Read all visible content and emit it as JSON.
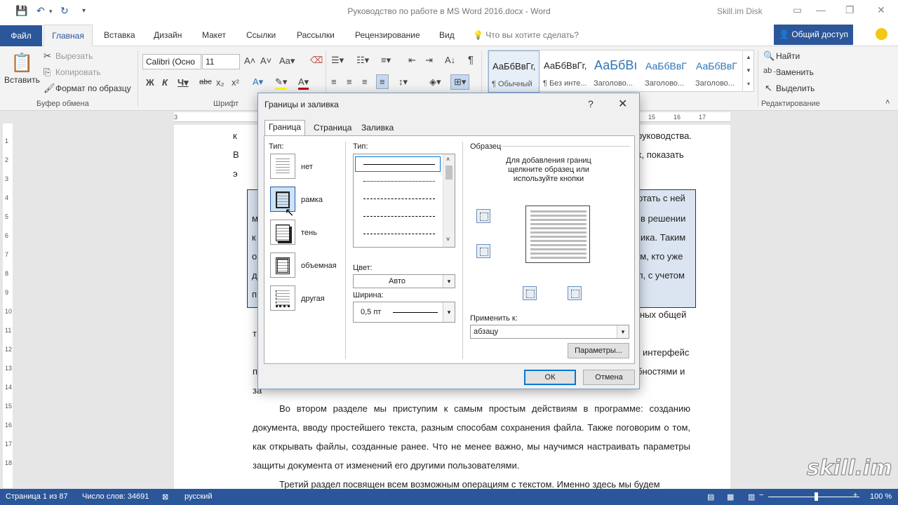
{
  "window": {
    "title": "Руководство по работе в MS Word 2016.docx - Word",
    "account": "Skill.im Disk"
  },
  "tabs": {
    "file": "Файл",
    "items": [
      "Главная",
      "Вставка",
      "Дизайн",
      "Макет",
      "Ссылки",
      "Рассылки",
      "Рецензирование",
      "Вид"
    ],
    "tell_me": "Что вы хотите сделать?",
    "share": "Общий доступ"
  },
  "ribbon": {
    "clipboard": {
      "label": "Буфер обмена",
      "paste": "Вставить",
      "cut": "Вырезать",
      "copy": "Копировать",
      "format_painter": "Формат по образцу"
    },
    "font": {
      "label": "Шрифт",
      "family": "Calibri (Осно",
      "size": "11"
    },
    "styles": [
      {
        "sample": "АаБбВвГг,",
        "name": "¶ Обычный"
      },
      {
        "sample": "АаБбВвГг,",
        "name": "¶ Без инте..."
      },
      {
        "sample": "АаБбВı",
        "name": "Заголово..."
      },
      {
        "sample": "АаБбВвГ",
        "name": "Заголово..."
      },
      {
        "sample": "АаБбВвГ",
        "name": "Заголово..."
      }
    ],
    "editing": {
      "label": "Редактирование",
      "find": "Найти",
      "replace": "Заменить",
      "select": "Выделить"
    }
  },
  "document": {
    "p1_fragments": [
      "к",
      "руководства.",
      "В",
      "х, показать",
      "э"
    ],
    "shaded_fragments": [
      "отать с ней",
      "м",
      "в решении",
      "к",
      "ика. Таким",
      "о",
      "ем, кто уже",
      "д",
      "л, с учетом",
      "п"
    ],
    "p2_fragments": [
      "ных общей",
      "т"
    ],
    "p3_fragments": [
      "интерфейс",
      "п",
      "бностями и",
      "за"
    ],
    "p4": "Во втором разделе мы приступим к самым простым действиям в программе: созданию документа, вводу простейшего текста, разным способам сохранения файла. Также поговорим о том, как открывать файлы, созданные ранее. Что не менее важно, мы научимся настраивать параметры защиты документа от изменений его другими пользователями.",
    "p5": "Третий раздел посвящен всем возможным операциям с текстом. Именно здесь мы будем"
  },
  "dialog": {
    "title": "Границы и заливка",
    "help": "?",
    "close": "✕",
    "tabs": [
      "Граница",
      "Страница",
      "Заливка"
    ],
    "type_label": "Тип:",
    "presets": [
      "нет",
      "рамка",
      "тень",
      "объемная",
      "другая"
    ],
    "line_type_label": "Тип:",
    "color_label": "Цвет:",
    "color_value": "Авто",
    "width_label": "Ширина:",
    "width_value": "0,5 пт",
    "preview_label": "Образец",
    "preview_hint": "Для добавления границ щелкните образец или используйте кнопки",
    "apply_label": "Применить к:",
    "apply_value": "абзацу",
    "options_button": "Параметры...",
    "ok": "ОК",
    "cancel": "Отмена"
  },
  "status": {
    "page": "Страница 1 из 87",
    "words": "Число слов: 34691",
    "language": "русский",
    "zoom": "100 %"
  },
  "watermark": "skill.im",
  "ruler": {
    "h_ticks": [
      "3",
      "15",
      "16",
      "17"
    ],
    "v_ticks": [
      "1",
      "2",
      "3",
      "4",
      "5",
      "6",
      "7",
      "8",
      "9",
      "10",
      "11",
      "12",
      "13",
      "14",
      "15",
      "16",
      "17",
      "18"
    ]
  }
}
